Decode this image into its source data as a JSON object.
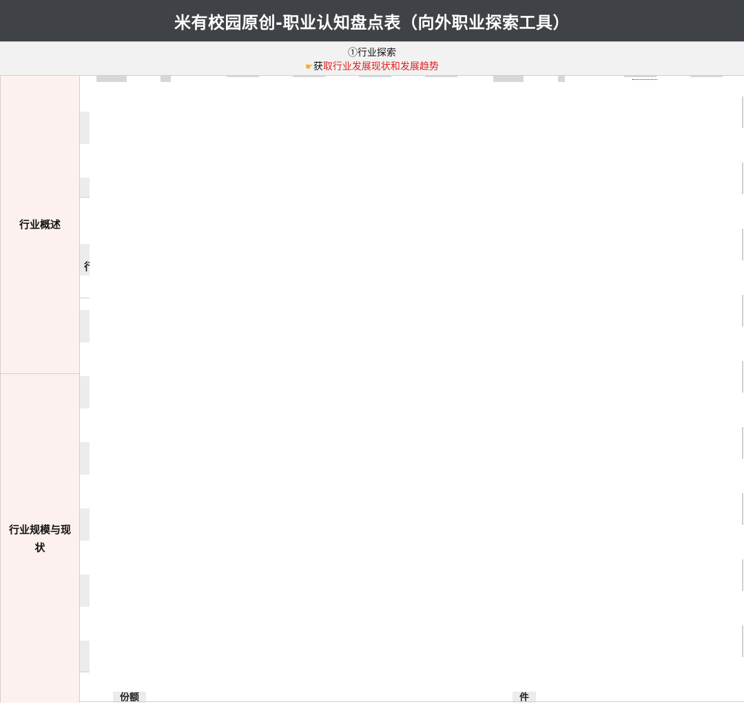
{
  "title": "米有校园原创-职业认知盘点表（向外职业探索工具）",
  "section": {
    "heading": "①行业探索",
    "hint_icon": "pointing-hand-icon",
    "hint_prefix": "获",
    "hint_red": "取行业发展现状和发展趋势"
  },
  "categories": [
    {
      "label": "行业概述"
    },
    {
      "label": "行业规模与现状"
    }
  ],
  "partial_text": "行",
  "bottom_labels": [
    "份额",
    "件"
  ],
  "colors": {
    "title_bg": "#3f4347",
    "header_bg": "#f2f2f2",
    "category_bg": "#fdf1ef",
    "accent_red": "#e02020"
  }
}
